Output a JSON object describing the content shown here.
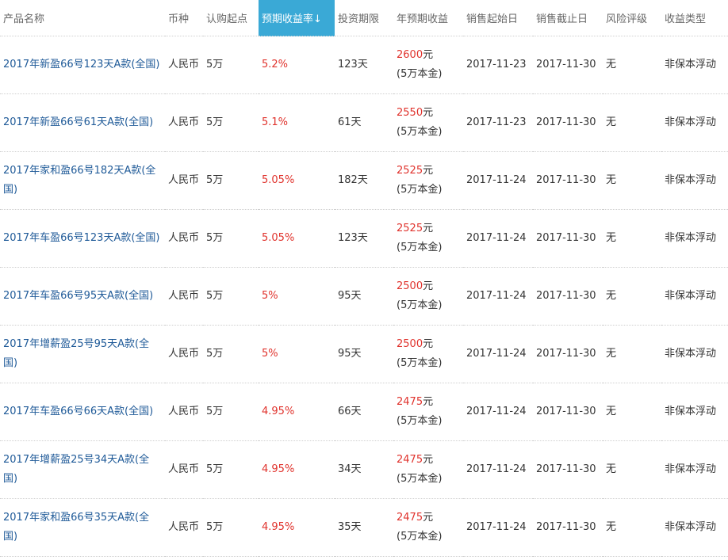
{
  "headers": {
    "name": "产品名称",
    "currency": "币种",
    "min": "认购起点",
    "yield": "预期收益率↓",
    "term": "投资期限",
    "earn": "年预期收益",
    "start": "销售起始日",
    "end": "销售截止日",
    "risk": "风险评级",
    "type": "收益类型"
  },
  "colors": {
    "sorted_header": "#3aa9d6",
    "link": "#1f5a98",
    "highlight": "#e0322c"
  },
  "rows": [
    {
      "name": "2017年新盈66号123天A款(全国)",
      "currency": "人民币",
      "min": "5万",
      "yield": "5.2%",
      "term": "123天",
      "earn_amount": "2600",
      "earn_unit": "元",
      "earn_note": "(5万本金)",
      "start": "2017-11-23",
      "end": "2017-11-30",
      "risk": "无",
      "type": "非保本浮动"
    },
    {
      "name": "2017年新盈66号61天A款(全国)",
      "currency": "人民币",
      "min": "5万",
      "yield": "5.1%",
      "term": "61天",
      "earn_amount": "2550",
      "earn_unit": "元",
      "earn_note": "(5万本金)",
      "start": "2017-11-23",
      "end": "2017-11-30",
      "risk": "无",
      "type": "非保本浮动"
    },
    {
      "name": "2017年家和盈66号182天A款(全国)",
      "currency": "人民币",
      "min": "5万",
      "yield": "5.05%",
      "term": "182天",
      "earn_amount": "2525",
      "earn_unit": "元",
      "earn_note": "(5万本金)",
      "start": "2017-11-24",
      "end": "2017-11-30",
      "risk": "无",
      "type": "非保本浮动"
    },
    {
      "name": "2017年车盈66号123天A款(全国)",
      "currency": "人民币",
      "min": "5万",
      "yield": "5.05%",
      "term": "123天",
      "earn_amount": "2525",
      "earn_unit": "元",
      "earn_note": "(5万本金)",
      "start": "2017-11-24",
      "end": "2017-11-30",
      "risk": "无",
      "type": "非保本浮动"
    },
    {
      "name": "2017年车盈66号95天A款(全国)",
      "currency": "人民币",
      "min": "5万",
      "yield": "5%",
      "term": "95天",
      "earn_amount": "2500",
      "earn_unit": "元",
      "earn_note": "(5万本金)",
      "start": "2017-11-24",
      "end": "2017-11-30",
      "risk": "无",
      "type": "非保本浮动"
    },
    {
      "name": "2017年增薪盈25号95天A款(全国)",
      "currency": "人民币",
      "min": "5万",
      "yield": "5%",
      "term": "95天",
      "earn_amount": "2500",
      "earn_unit": "元",
      "earn_note": "(5万本金)",
      "start": "2017-11-24",
      "end": "2017-11-30",
      "risk": "无",
      "type": "非保本浮动"
    },
    {
      "name": "2017年车盈66号66天A款(全国)",
      "currency": "人民币",
      "min": "5万",
      "yield": "4.95%",
      "term": "66天",
      "earn_amount": "2475",
      "earn_unit": "元",
      "earn_note": "(5万本金)",
      "start": "2017-11-24",
      "end": "2017-11-30",
      "risk": "无",
      "type": "非保本浮动"
    },
    {
      "name": "2017年增薪盈25号34天A款(全国)",
      "currency": "人民币",
      "min": "5万",
      "yield": "4.95%",
      "term": "34天",
      "earn_amount": "2475",
      "earn_unit": "元",
      "earn_note": "(5万本金)",
      "start": "2017-11-24",
      "end": "2017-11-30",
      "risk": "无",
      "type": "非保本浮动"
    },
    {
      "name": "2017年家和盈66号35天A款(全国)",
      "currency": "人民币",
      "min": "5万",
      "yield": "4.95%",
      "term": "35天",
      "earn_amount": "2475",
      "earn_unit": "元",
      "earn_note": "(5万本金)",
      "start": "2017-11-24",
      "end": "2017-11-30",
      "risk": "无",
      "type": "非保本浮动"
    }
  ]
}
